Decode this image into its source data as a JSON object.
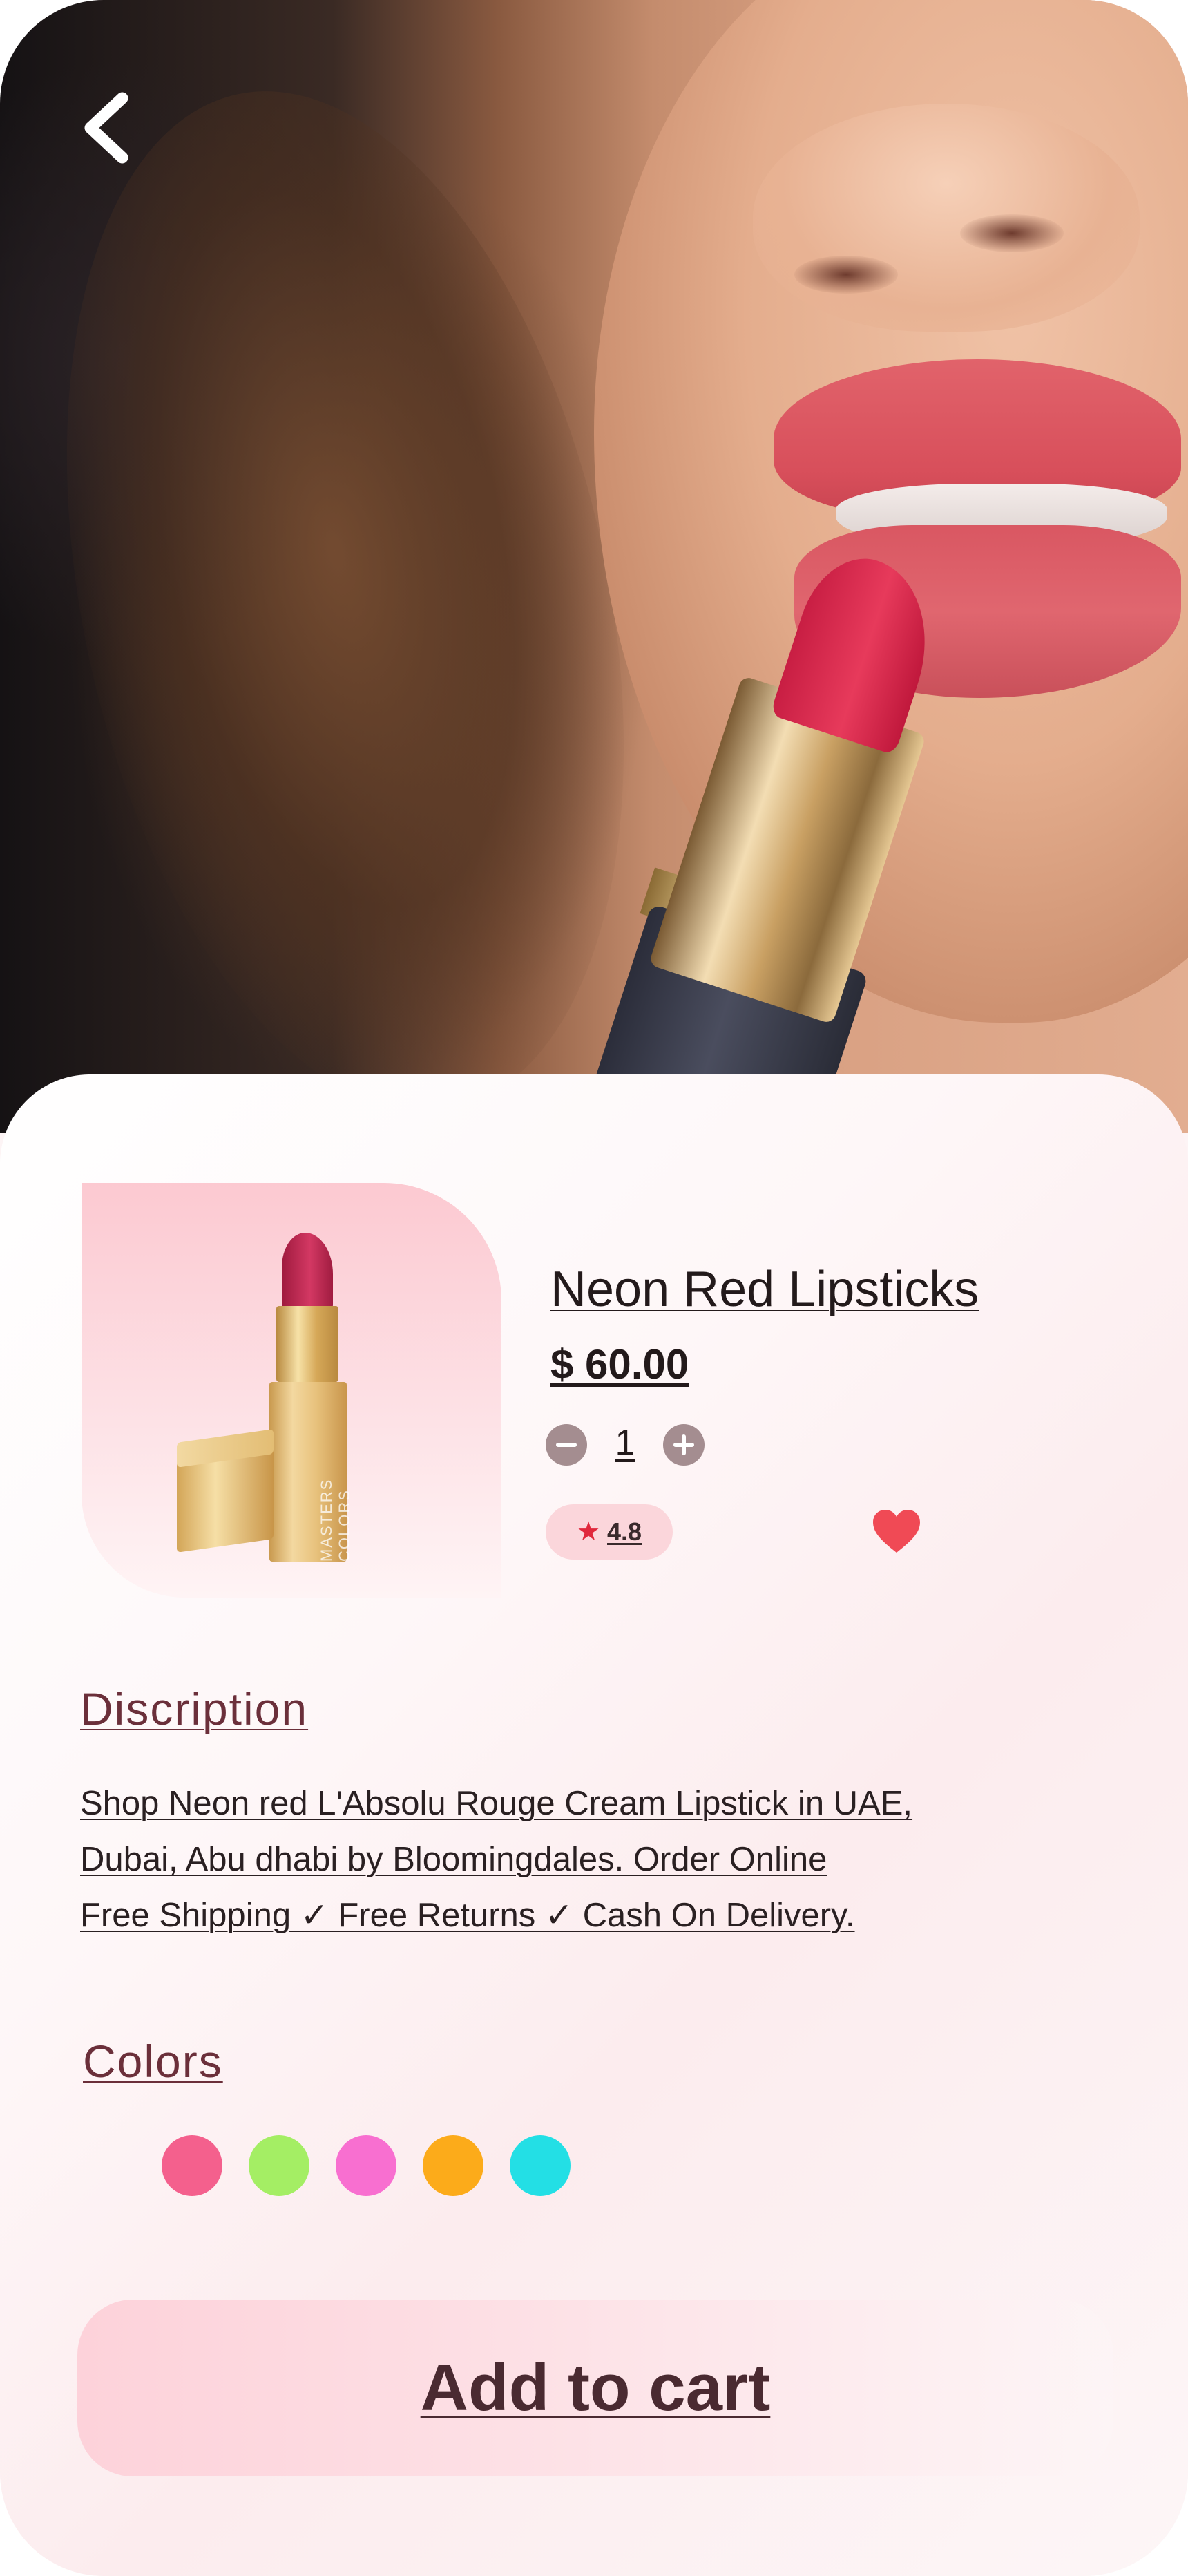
{
  "app": {
    "accent": "#6b2f3a",
    "background": "#fdf4f5"
  },
  "hero": {
    "back_icon": "chevron-left-icon"
  },
  "product": {
    "title": "Neon Red Lipsticks",
    "price": "$ 60.00",
    "quantity": "1",
    "rating": "4.8",
    "rating_icon": "star-icon",
    "favorite_icon": "heart-icon",
    "favorite_color": "#f04a55",
    "thumbnail_text": "MASTERS COLORS"
  },
  "description": {
    "heading": "Discription",
    "lines": [
      "Shop Neon red L'Absolu Rouge Cream Lipstick in UAE,",
      "Dubai, Abu dhabi by Bloomingdales. Order Online",
      "Free Shipping ✓ Free Returns ✓ Cash On Delivery."
    ]
  },
  "colors": {
    "heading": "Colors",
    "swatches": [
      "#f4608d",
      "#a4ee64",
      "#f86fd0",
      "#fcab1a",
      "#23dfe5"
    ]
  },
  "cart": {
    "label": "Add to cart"
  }
}
